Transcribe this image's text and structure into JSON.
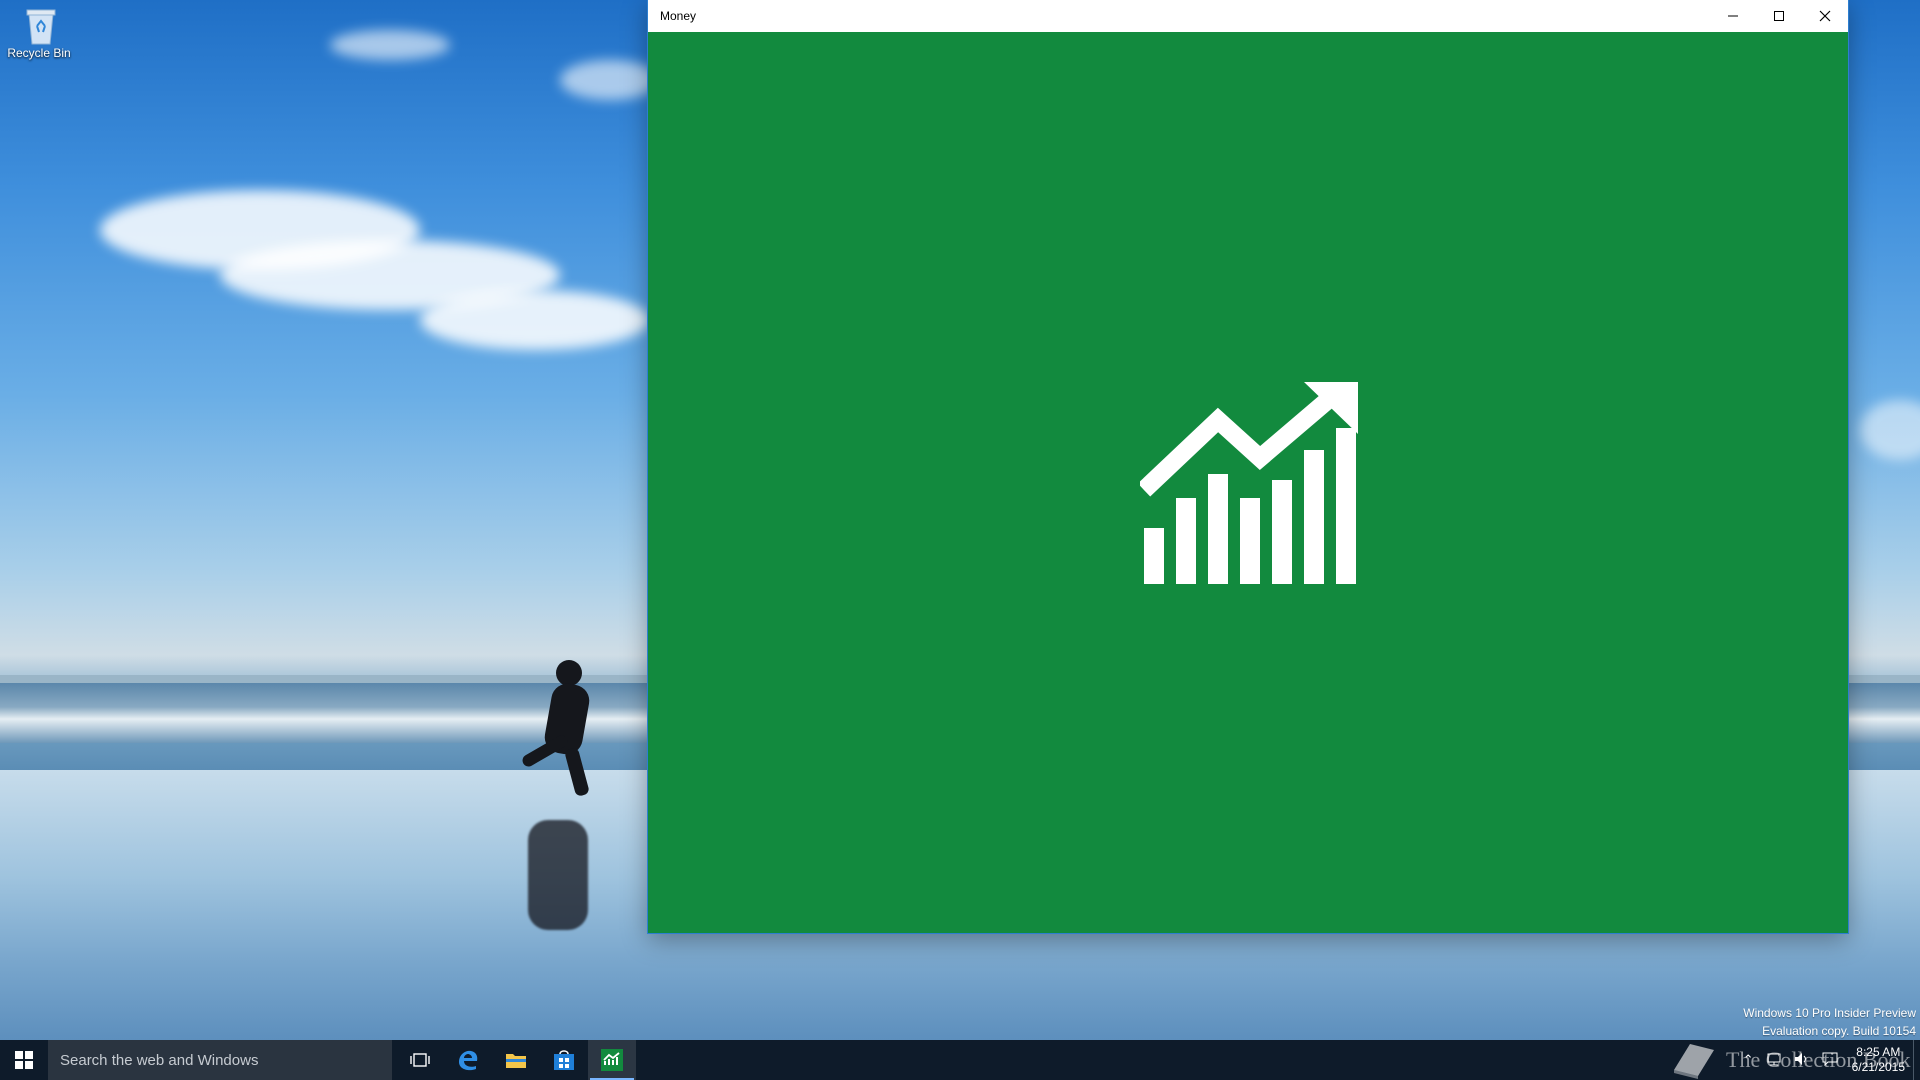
{
  "desktop": {
    "recycle_bin_label": "Recycle Bin"
  },
  "window": {
    "title": "Money",
    "app_color": "#128a3e",
    "controls": {
      "minimize": "minimize-icon",
      "maximize": "maximize-icon",
      "close": "close-icon"
    },
    "splash_icon": "chart-trend-icon"
  },
  "watermark": {
    "line1": "Windows 10 Pro Insider Preview",
    "line2": "Evaluation copy. Build 10154"
  },
  "taskbar": {
    "search_placeholder": "Search the web and Windows",
    "apps": [
      "task-view-icon",
      "edge-icon",
      "file-explorer-icon",
      "store-icon",
      "money-icon"
    ],
    "active_app": "money-icon"
  },
  "tray": {
    "time": "8:25 AM",
    "date": "6/21/2015",
    "brand": "The Collection Book"
  }
}
